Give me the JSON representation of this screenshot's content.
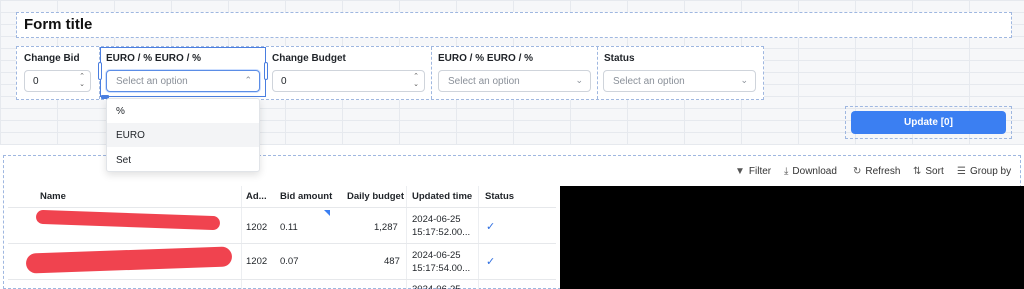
{
  "form": {
    "title": "Form title",
    "change_bid": {
      "label": "Change Bid",
      "value": "0"
    },
    "bid_unit": {
      "label": "EURO / % EURO / %",
      "placeholder": "Select an option",
      "options": [
        "%",
        "EURO",
        "Set"
      ]
    },
    "change_budget": {
      "label": "Change Budget",
      "value": "0"
    },
    "budget_unit": {
      "label": "EURO / % EURO / %",
      "placeholder": "Select an option"
    },
    "status": {
      "label": "Status",
      "placeholder": "Select an option"
    },
    "update_label": "Update [0]"
  },
  "toolbar": {
    "filter": "Filter",
    "download": "Download",
    "refresh": "Refresh",
    "sort": "Sort",
    "group_by": "Group by"
  },
  "table": {
    "headers": [
      "Name",
      "Ad...",
      "Bid amount",
      "Daily budget",
      "Updated time",
      "Status"
    ],
    "rows": [
      {
        "ad": "1202",
        "bid": "0.11",
        "budget": "1,287",
        "time_date": "2024-06-25",
        "time_clock": "15:17:52.00..."
      },
      {
        "ad": "1202",
        "bid": "0.07",
        "budget": "487",
        "time_date": "2024-06-25",
        "time_clock": "15:17:54.00..."
      },
      {
        "time_date": "2024-06-25"
      }
    ]
  },
  "colors": {
    "accent": "#3b7ff2",
    "selection": "#4a7ee0",
    "redaction": "#f0434f",
    "check": "#2f6fe0"
  },
  "icons": [
    "chevron-down-icon",
    "filter-icon",
    "download-icon",
    "refresh-icon",
    "sort-icon",
    "group-by-icon",
    "checkmark-icon"
  ]
}
